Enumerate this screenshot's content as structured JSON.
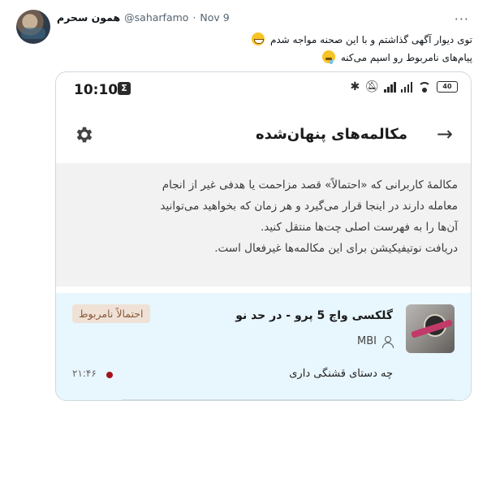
{
  "tweet": {
    "display_name": "همون سحرم",
    "handle": "@saharfamo",
    "separator": "·",
    "date": "Nov 9",
    "more_icon": "more-icon",
    "line1": "توی دیوار آگهی گذاشتم و با این صحنه مواجه شدم",
    "line1_emoji": "grinning-sweat-emoji",
    "line2": "پیام‌های نامربوط رو اسپم می‌کنه",
    "line2_emoji": "drooling-face-emoji"
  },
  "phone": {
    "status": {
      "time": "10:10",
      "notification_icon": "Σ",
      "battery": "40"
    },
    "appbar": {
      "title": "مکالمه‌های پنهان‌شده",
      "back_icon": "→",
      "settings_icon": "gear-icon"
    },
    "info": {
      "lines": [
        "مکالمهٔ کاربرانی که «احتمالاً» قصد مزاحمت یا هدفی غیر از انجام",
        "معامله دارند در اینجا قرار می‌گیرد و هر زمان که بخواهید می‌توانید",
        "آن‌ها را به فهرست اصلی چت‌ها منتقل کنید.",
        "دریافت نوتیفیکیشن برای این مکالمه‌ها غیرفعال است."
      ]
    },
    "conversation": {
      "title": "گلکسی واچ 5 پرو - در حد نو",
      "seller": "MBI",
      "badge": "احتمالاً نامربوط",
      "message": "چه دستای قشنگی داری",
      "time": "۲۱:۴۶"
    }
  },
  "colors": {
    "info_bg": "#f2f2f2",
    "row_bg": "#e8f6fd",
    "badge_bg": "#efe1d6",
    "badge_text": "#8a5a3c",
    "unread_dot": "#a5121a"
  }
}
